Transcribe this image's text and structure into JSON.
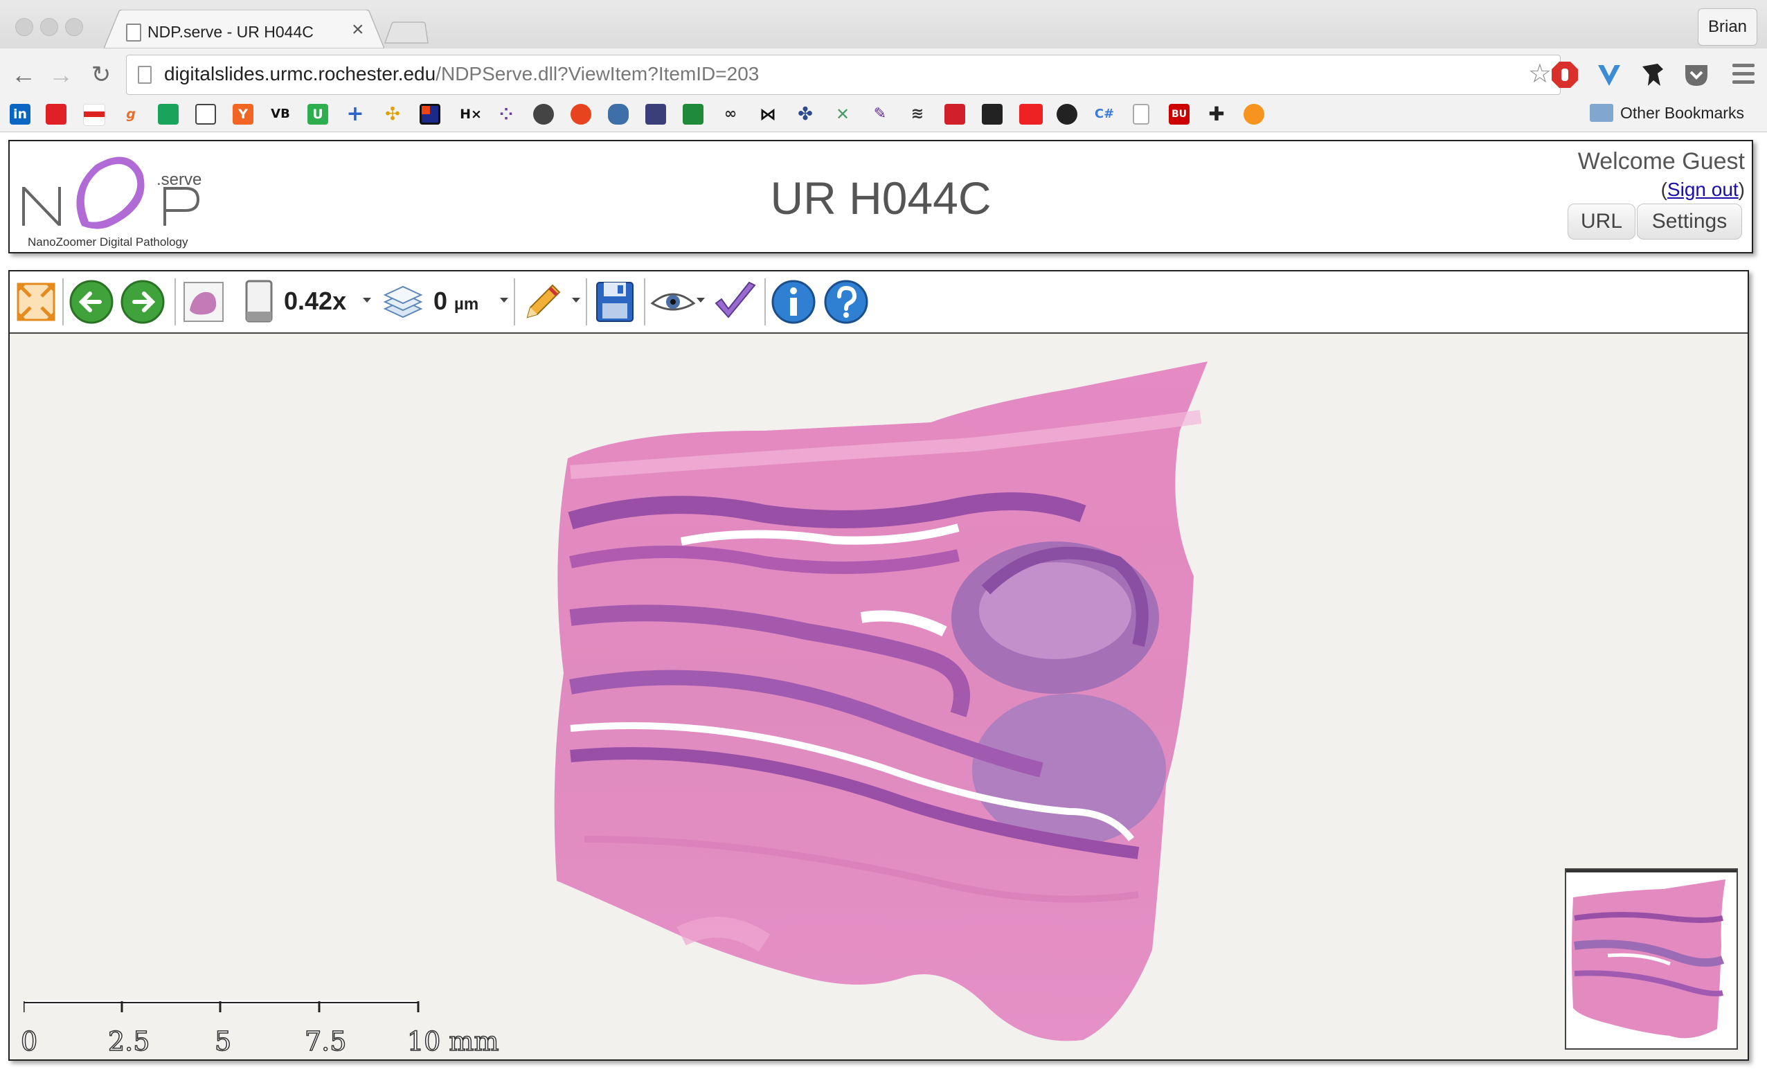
{
  "browser": {
    "tab_title": "NDP.serve - UR H044C",
    "tab_close": "×",
    "profile_name": "Brian",
    "url_host": "digitalslides.urmc.rochester.edu",
    "url_path": "/NDPServe.dll?ViewItem?ItemID=203",
    "other_bookmarks_label": "Other Bookmarks",
    "bookmark_texts": [
      "in",
      "g",
      "Y",
      "VB",
      "U",
      "+",
      "H×",
      "C#",
      "BU"
    ]
  },
  "header": {
    "logo_text": "NDP",
    "logo_serve": ".serve",
    "logo_caption": "NanoZoomer Digital Pathology",
    "slide_title": "UR H044C",
    "welcome_text": "Welcome Guest",
    "signout_open": "(",
    "signout_label": "Sign out",
    "signout_close": ")",
    "url_button": "URL",
    "settings_button": "Settings"
  },
  "viewer_toolbar": {
    "zoom": "0.42x",
    "focus_value": "0",
    "focus_unit": "µm"
  },
  "scalebar": {
    "labels": [
      "0",
      "2.5",
      "5",
      "7.5",
      "10 mm"
    ]
  },
  "colors": {
    "stain_pink": "#e48bc0",
    "stain_purple": "#9a5aa6",
    "viewer_background": "#f2f1ee"
  }
}
